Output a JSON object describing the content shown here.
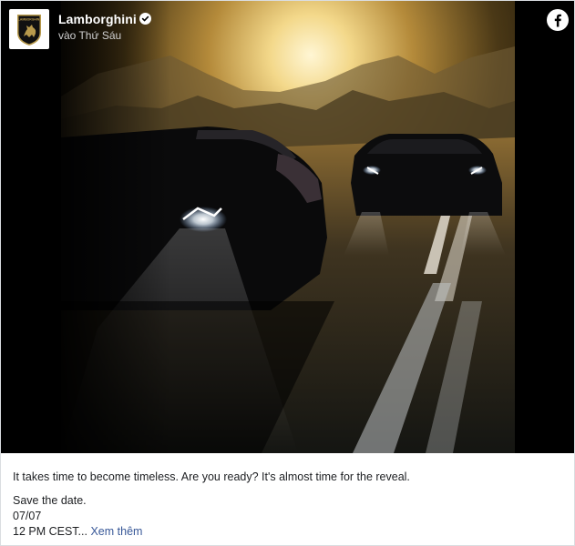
{
  "post": {
    "page_name": "Lamborghini",
    "timestamp": "vào Thứ Sáu",
    "verified": true,
    "avatar_icon": "lamborghini-bull-shield-icon",
    "logo_text": "LAMBORGHINI",
    "platform_icon": "facebook-icon",
    "caption": {
      "line1": "It takes time to become timeless. Are you ready? It's almost time for the reveal.",
      "line2": "Save the date.",
      "line3": "07/07",
      "line4": "12 PM CEST...",
      "see_more": "Xem thêm"
    }
  },
  "colors": {
    "facebook_blue": "#1877f2",
    "link_blue": "#385898",
    "avatar_gold": "#b89a4c"
  }
}
